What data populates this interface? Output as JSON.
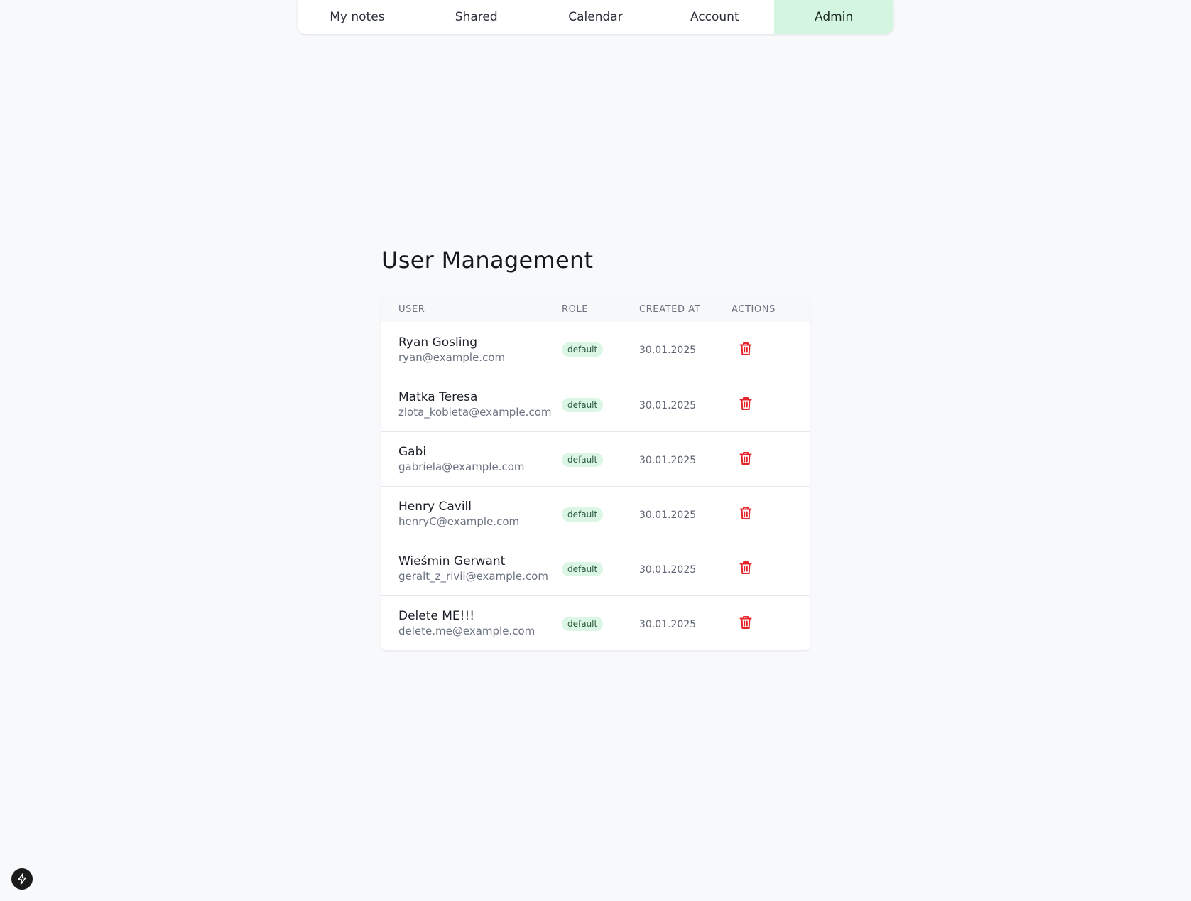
{
  "nav": {
    "items": [
      {
        "label": "My notes"
      },
      {
        "label": "Shared"
      },
      {
        "label": "Calendar"
      },
      {
        "label": "Account"
      },
      {
        "label": "Admin"
      }
    ],
    "active_index": 4,
    "active_color": "#d4f6e1"
  },
  "page": {
    "title": "User Management"
  },
  "table": {
    "columns": {
      "user": "USER",
      "role": "ROLE",
      "created_at": "CREATED AT",
      "actions": "ACTIONS"
    },
    "rows": [
      {
        "name": "Ryan Gosling",
        "email": "ryan@example.com",
        "role": "default",
        "created_at": "30.01.2025",
        "action_icon": "trash-icon"
      },
      {
        "name": "Matka Teresa",
        "email": "zlota_kobieta@example.com",
        "role": "default",
        "created_at": "30.01.2025",
        "action_icon": "trash-icon"
      },
      {
        "name": "Gabi",
        "email": "gabriela@example.com",
        "role": "default",
        "created_at": "30.01.2025",
        "action_icon": "trash-icon"
      },
      {
        "name": "Henry Cavill",
        "email": "henryC@example.com",
        "role": "default",
        "created_at": "30.01.2025",
        "action_icon": "trash-icon"
      },
      {
        "name": "Wieśmin Gerwant",
        "email": "geralt_z_rivii@example.com",
        "role": "default",
        "created_at": "30.01.2025",
        "action_icon": "trash-icon"
      },
      {
        "name": "Delete ME!!!",
        "email": "delete.me@example.com",
        "role": "default",
        "created_at": "30.01.2025",
        "action_icon": "trash-icon"
      }
    ]
  },
  "colors": {
    "danger": "#e5252a",
    "badge_bg": "#dcf6e6",
    "background": "#f8f9fb"
  },
  "dev_badge": {
    "icon": "bolt-icon"
  }
}
